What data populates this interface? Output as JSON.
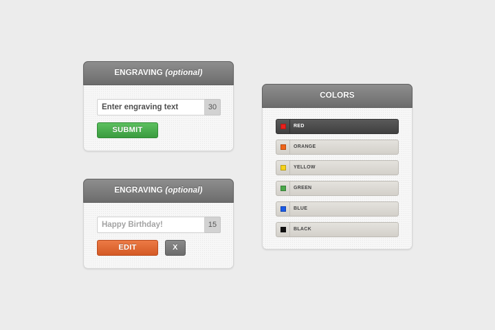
{
  "engraving_empty": {
    "title": "ENGRAVING",
    "title_optional": "(optional)",
    "input_placeholder": "Enter engraving text",
    "input_value": "",
    "char_count": "30",
    "submit_label": "SUBMIT"
  },
  "engraving_filled": {
    "title": "ENGRAVING",
    "title_optional": "(optional)",
    "input_value": "Happy Birthday!",
    "char_count": "15",
    "edit_label": "EDIT",
    "clear_label": "X"
  },
  "colors": {
    "title": "COLORS",
    "items": [
      {
        "label": "RED",
        "swatch": "#e8201c",
        "selected": true
      },
      {
        "label": "ORANGE",
        "swatch": "#f06418",
        "selected": false
      },
      {
        "label": "YELLOW",
        "swatch": "#f6d21a",
        "selected": false
      },
      {
        "label": "GREEN",
        "swatch": "#4aa84a",
        "selected": false
      },
      {
        "label": "BLUE",
        "swatch": "#1a5ae6",
        "selected": false
      },
      {
        "label": "BLACK",
        "swatch": "#111111",
        "selected": false
      }
    ]
  },
  "palette": {
    "header": "#7a7a7a",
    "submit": "#46a84a",
    "edit": "#e06a33",
    "clear": "#777777"
  }
}
